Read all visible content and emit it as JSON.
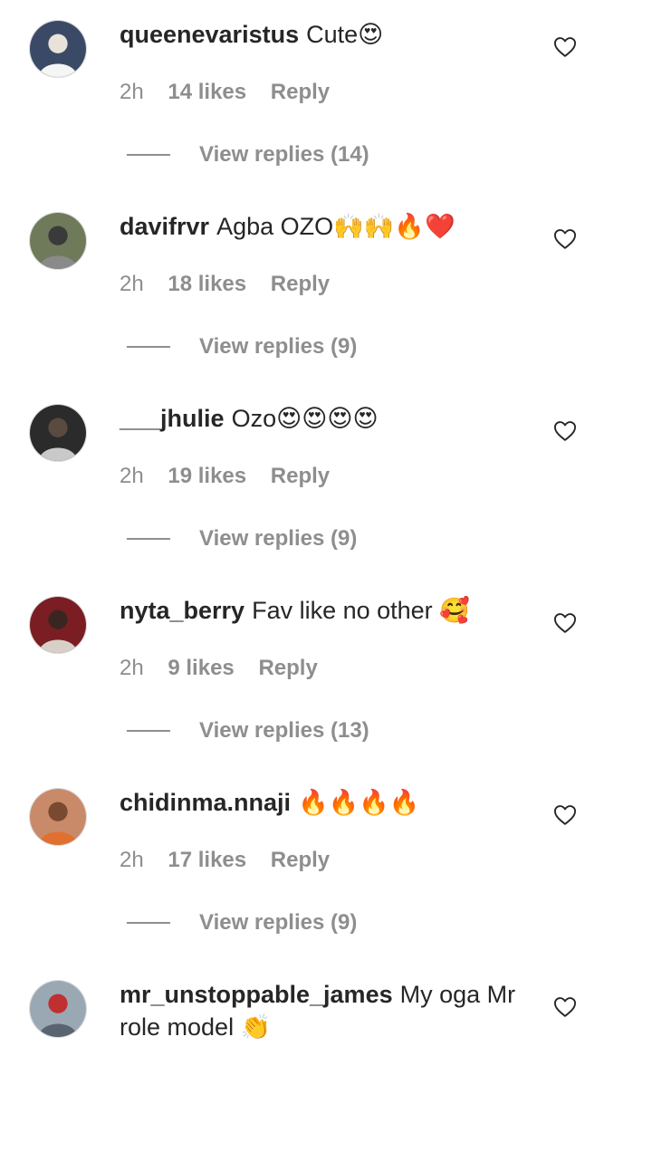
{
  "comments": [
    {
      "username": "queenevaristus",
      "text": "Cute😍",
      "time": "2h",
      "likes": "14 likes",
      "reply": "Reply",
      "view_replies": "View replies (14)",
      "avatar_icon": "user-photo"
    },
    {
      "username": "davifrvr",
      "text": "Agba OZO🙌🙌🔥❤️",
      "time": "2h",
      "likes": "18 likes",
      "reply": "Reply",
      "view_replies": "View replies (9)",
      "avatar_icon": "user-photo"
    },
    {
      "username": "___jhulie",
      "text": "Ozo😍😍😍😍",
      "time": "2h",
      "likes": "19 likes",
      "reply": "Reply",
      "view_replies": "View replies (9)",
      "avatar_icon": "user-photo"
    },
    {
      "username": "nyta_berry",
      "text": "Fav like no other 🥰",
      "time": "2h",
      "likes": "9 likes",
      "reply": "Reply",
      "view_replies": "View replies (13)",
      "avatar_icon": "user-photo"
    },
    {
      "username": "chidinma.nnaji",
      "text": "🔥🔥🔥🔥",
      "time": "2h",
      "likes": "17 likes",
      "reply": "Reply",
      "view_replies": "View replies (9)",
      "avatar_icon": "user-photo"
    },
    {
      "username": "mr_unstoppable_james",
      "text": "My oga Mr role model 👏",
      "time": "",
      "likes": "",
      "reply": "",
      "view_replies": "",
      "avatar_icon": "user-photo"
    }
  ],
  "icons": {
    "like": "heart-outline-icon"
  },
  "colors": {
    "primary_text": "#262626",
    "secondary_text": "#8e8e8e",
    "background": "#ffffff"
  }
}
